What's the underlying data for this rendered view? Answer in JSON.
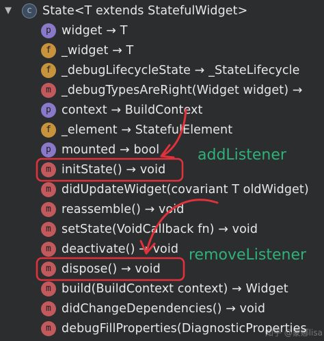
{
  "tree": {
    "root": {
      "arrow": "▼",
      "badge": "c",
      "label": "State<T extends StatefulWidget>"
    },
    "members": [
      {
        "badge": "p",
        "label": "widget → T"
      },
      {
        "badge": "f",
        "label": "_widget → T"
      },
      {
        "badge": "f",
        "label": "_debugLifecycleState → _StateLifecycle"
      },
      {
        "badge": "m",
        "label": "_debugTypesAreRight(Widget widget) →"
      },
      {
        "badge": "p",
        "label": "context → BuildContext"
      },
      {
        "badge": "f",
        "label": "_element → StatefulElement"
      },
      {
        "badge": "p",
        "label": "mounted → bool"
      },
      {
        "badge": "m",
        "label": "initState() → void"
      },
      {
        "badge": "m",
        "label": "didUpdateWidget(covariant T oldWidget)"
      },
      {
        "badge": "m",
        "label": "reassemble() → void"
      },
      {
        "badge": "m",
        "label": "setState(VoidCallback fn) → void"
      },
      {
        "badge": "m",
        "label": "deactivate() → void"
      },
      {
        "badge": "m",
        "label": "dispose() → void"
      },
      {
        "badge": "m",
        "label": "build(BuildContext context) → Widget"
      },
      {
        "badge": "m",
        "label": "didChangeDependencies() → void"
      },
      {
        "badge": "m",
        "label": "debugFillProperties(DiagnosticProperties"
      }
    ]
  },
  "annotations": {
    "add": "addListener",
    "remove": "removeListener",
    "color": "#2fb27a",
    "highlight_color": "#e0323c"
  },
  "watermark": "知乎 @蒙娜lisa"
}
